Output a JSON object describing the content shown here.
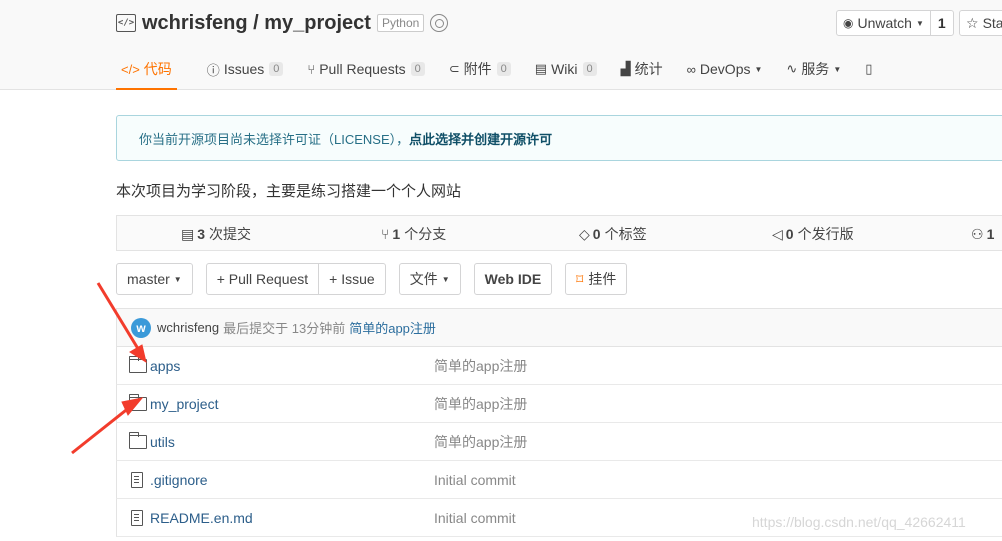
{
  "repo": {
    "owner": "wchrisfeng",
    "separator": " / ",
    "name": "my_project",
    "language": "Python"
  },
  "actions": {
    "watch_label": "Unwatch",
    "watch_count": "1",
    "star_label": "Sta"
  },
  "tabs": [
    {
      "label": "代码",
      "icon": "code-icon",
      "count": null
    },
    {
      "label": "Issues",
      "icon": "issue-icon",
      "count": "0"
    },
    {
      "label": "Pull Requests",
      "icon": "pull-request-icon",
      "count": "0"
    },
    {
      "label": "附件",
      "icon": "attachment-icon",
      "count": "0"
    },
    {
      "label": "Wiki",
      "icon": "wiki-icon",
      "count": "0"
    },
    {
      "label": "统计",
      "icon": "chart-icon",
      "count": null
    },
    {
      "label": "DevOps",
      "icon": "devops-icon",
      "count": null
    },
    {
      "label": "服务",
      "icon": "service-icon",
      "count": null
    }
  ],
  "license": {
    "text": "你当前开源项目尚未选择许可证（LICENSE），",
    "link": "点此选择并创建开源许可"
  },
  "description": "本次项目为学习阶段，主要是练习搭建一个个人网站",
  "stats": [
    {
      "value": "3",
      "label": "次提交"
    },
    {
      "value": "1",
      "label": "个分支"
    },
    {
      "value": "0",
      "label": "个标签"
    },
    {
      "value": "0",
      "label": "个发行版"
    },
    {
      "value": "1",
      "label": ""
    }
  ],
  "toolbar": {
    "branch": "master",
    "pull_request": "+ Pull Request",
    "issue": "+ Issue",
    "file": "文件",
    "web_ide": "Web IDE",
    "widget": "挂件"
  },
  "last_commit": {
    "avatar_letter": "w",
    "user": "wchrisfeng",
    "meta": "最后提交于 13分钟前",
    "message": "简单的app注册"
  },
  "files": [
    {
      "name": "apps",
      "type": "folder",
      "commit": "简单的app注册"
    },
    {
      "name": "my_project",
      "type": "folder",
      "commit": "简单的app注册"
    },
    {
      "name": "utils",
      "type": "folder",
      "commit": "简单的app注册"
    },
    {
      "name": ".gitignore",
      "type": "file",
      "commit": "Initial commit"
    },
    {
      "name": "README.en.md",
      "type": "file",
      "commit": "Initial commit"
    }
  ],
  "watermark": "https://blog.csdn.net/qq_42662411",
  "colors": {
    "accent": "#fe7300",
    "arrow": "#f23c2c",
    "link": "#2c5e8a"
  }
}
